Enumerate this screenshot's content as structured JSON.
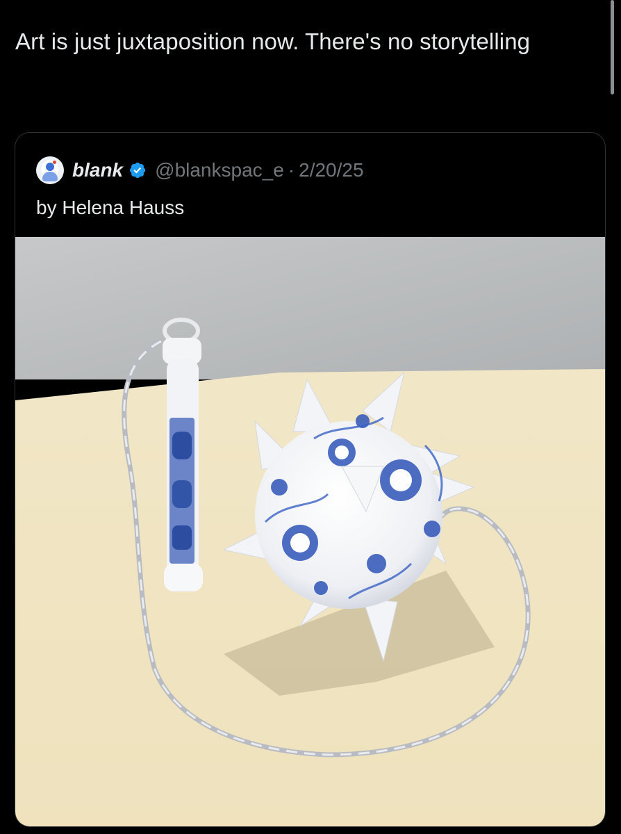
{
  "post": {
    "text": "Art is just juxtaposition now. There's no storytelling"
  },
  "quote": {
    "author_name": "blank",
    "handle": "@blankspac_e",
    "separator": "·",
    "date": "2/20/25",
    "text": "by Helena Hauss",
    "verified_color": "#1d9bf0"
  },
  "media": {
    "subject": "blue-and-white porcelain mace with chain"
  }
}
